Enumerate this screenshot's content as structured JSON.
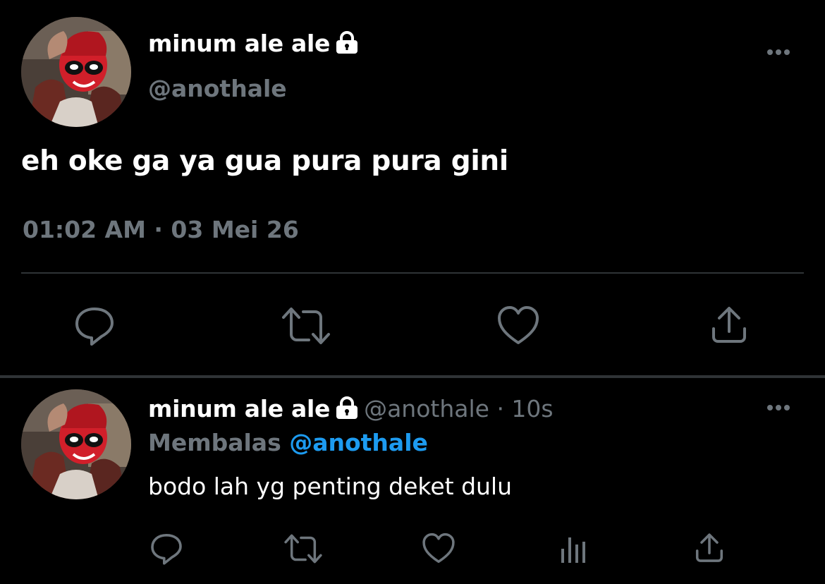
{
  "tweet": {
    "author": {
      "display_name": "minum ale ale",
      "handle": "@anothale",
      "protected": true
    },
    "text": "eh oke ga ya gua pura pura gini",
    "timestamp": "01:02 AM · 03 Mei 26"
  },
  "reply": {
    "author": {
      "display_name": "minum ale ale",
      "handle": "@anothale",
      "protected": true
    },
    "meta": "@anothale · 10s",
    "replying_label": "Membalas",
    "replying_to": "@anothale",
    "text": "bodo lah yg penting deket dulu"
  },
  "icons": {
    "reply": "reply-icon",
    "retweet": "retweet-icon",
    "like": "heart-icon",
    "share": "share-icon",
    "analytics": "analytics-icon",
    "more": "more-icon",
    "lock": "lock-icon"
  },
  "colors": {
    "background": "#000000",
    "text_primary": "#ffffff",
    "text_secondary": "#6e767d",
    "divider": "#2f3336",
    "accent": "#1d9bf0"
  }
}
